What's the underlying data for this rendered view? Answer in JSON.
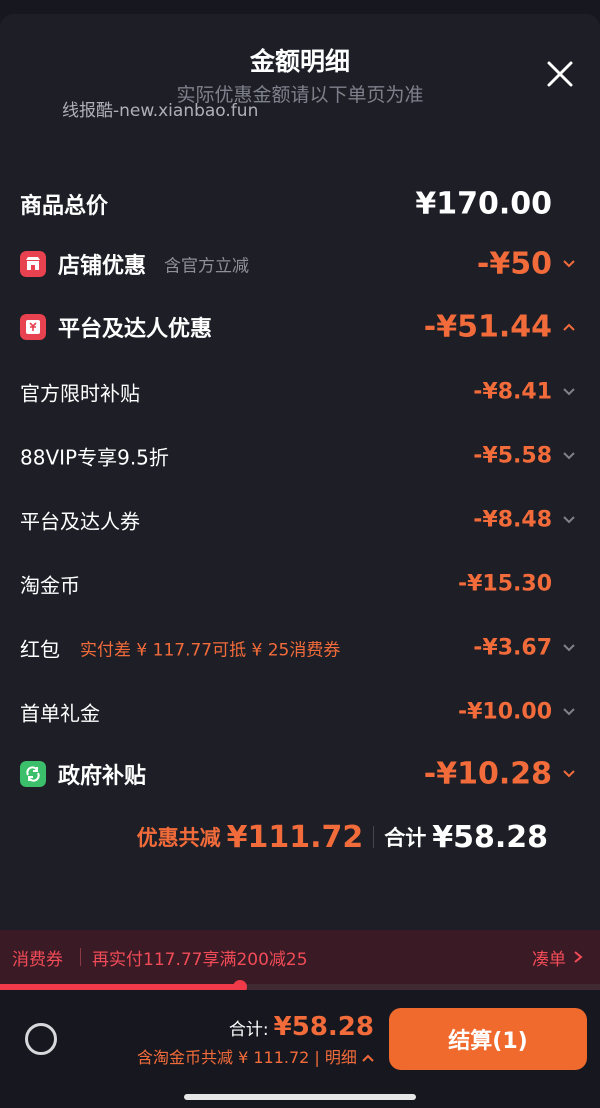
{
  "header": {
    "title": "金额明细",
    "subtitle": "实际优惠金额请以下单页为准",
    "watermark": "线报酷-new.xianbao.fun"
  },
  "rows": [
    {
      "label": "商品总价",
      "amount": "¥170.00",
      "icon": "",
      "note": ""
    },
    {
      "label": "店铺优惠",
      "amount": "-¥50",
      "icon": "store-icon",
      "note": "含官方立减"
    },
    {
      "label": "平台及达人优惠",
      "amount": "-¥51.44",
      "icon": "coupon-icon",
      "note": ""
    },
    {
      "label": "官方限时补贴",
      "amount": "-¥8.41"
    },
    {
      "label": "88VIP专享9.5折",
      "amount": "-¥5.58"
    },
    {
      "label": "平台及达人券",
      "amount": "-¥8.48"
    },
    {
      "label": "淘金币",
      "amount": "-¥15.30"
    },
    {
      "label": "红包",
      "amount": "-¥3.67",
      "note": "实付差 ¥ 117.77可抵 ¥ 25消费券"
    },
    {
      "label": "首单礼金",
      "amount": "-¥10.00"
    },
    {
      "label": "政府补贴",
      "amount": "-¥10.28",
      "icon": "refresh-icon"
    }
  ],
  "summary": {
    "discount_label": "优惠共减",
    "discount_value": "¥111.72",
    "total_label": "合计",
    "total_value": "¥58.28"
  },
  "coupon_bar": {
    "tag": "消费券",
    "desc": "再实付117.77享满200减25",
    "link": "凑单",
    "progress": 0.4
  },
  "bottom": {
    "total_label": "合计:",
    "total_value": "¥58.28",
    "detail": "含淘金币共减 ¥ 111.72 | 明细",
    "checkout": "结算(1)"
  },
  "colors": {
    "accent": "#f26b3a",
    "red": "#f04b57",
    "background": "#1d1e26"
  }
}
